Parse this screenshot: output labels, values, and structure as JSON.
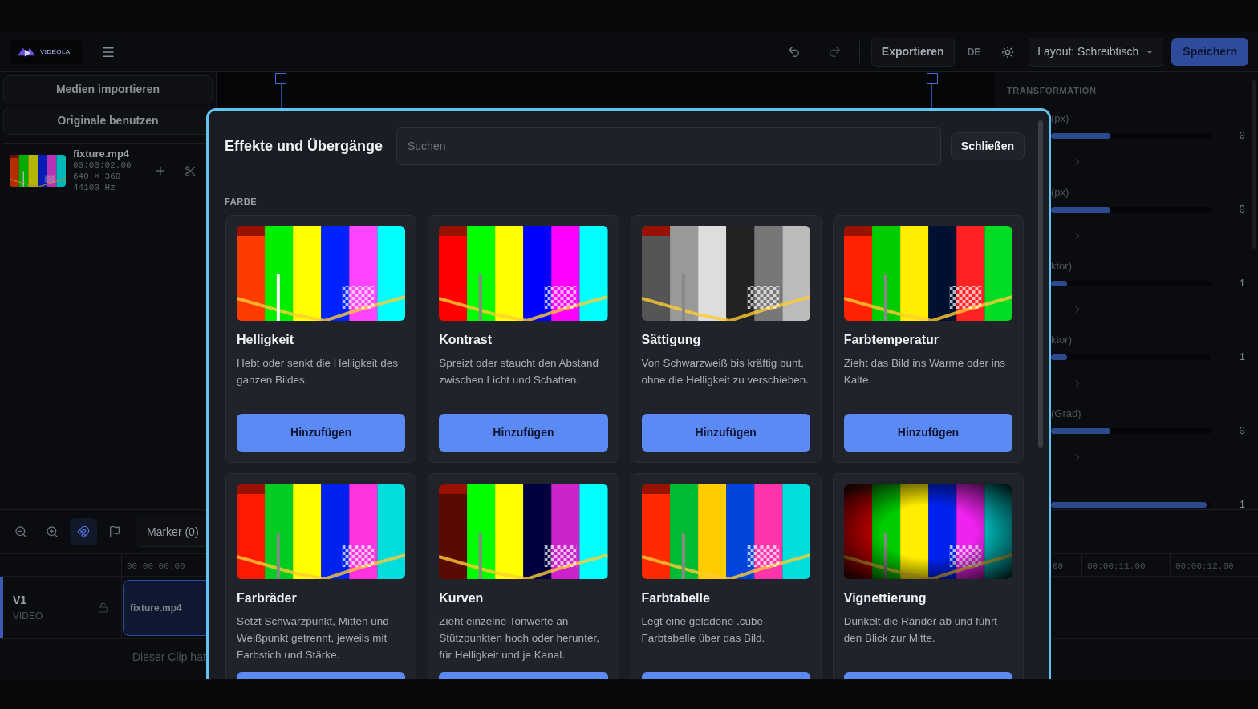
{
  "topbar": {
    "logo_text": "VIDEOLA",
    "export": "Exportieren",
    "language": "DE",
    "layout_select": "Layout: Schreibtisch",
    "save": "Speichern"
  },
  "media_panel": {
    "buttons": [
      "Medien importieren",
      "Originale benutzen"
    ],
    "items": [
      {
        "name": "fixture.mp4",
        "duration": "00:00:02.00",
        "resolution": "640 × 360",
        "sample_rate": "44100 Hz"
      }
    ]
  },
  "inspector": {
    "section": "TRANSFORMATION",
    "rows": [
      {
        "label": "(px)",
        "level": 0.37,
        "value": "0"
      },
      {
        "label": "(px)",
        "level": 0.37,
        "value": "0"
      },
      {
        "label": "ktor)",
        "level": 0.1,
        "value": "1"
      },
      {
        "label": "ktor)",
        "level": 0.1,
        "value": "1"
      },
      {
        "label": "(Grad)",
        "level": 0.37,
        "value": "0"
      },
      {
        "level": 0.97,
        "value": "1"
      }
    ]
  },
  "timeline": {
    "tools": [
      {
        "kind": "zoom-out",
        "selected": false
      },
      {
        "kind": "zoom-in",
        "selected": false
      },
      {
        "kind": "magnet",
        "selected": true
      },
      {
        "kind": "flag",
        "selected": false
      }
    ],
    "marker_button": "Marker (0)",
    "ruler": [
      "00:00:00.00",
      "00",
      "00:00:11.00",
      "00:00:12.00"
    ],
    "tracks": [
      {
        "name": "V1",
        "type": "VIDEO",
        "clip": "fixture.mp4"
      }
    ],
    "notice": "Dieser Clip hat"
  },
  "dialog": {
    "title": "Effekte und Übergänge",
    "search": {
      "placeholder": "Suchen"
    },
    "close": "Schließen",
    "section": "FARBE",
    "effects": [
      {
        "title": "Helligkeit",
        "description": "Hebt oder senkt die Helligkeit des ganzen Bildes.",
        "button": "Hinzufügen"
      },
      {
        "title": "Kontrast",
        "description": "Spreizt oder staucht den Abstand zwischen Licht und Schatten.",
        "button": "Hinzufügen"
      },
      {
        "title": "Sättigung",
        "description": "Von Schwarzweiß bis kräftig bunt, ohne die Helligkeit zu verschieben.",
        "button": "Hinzufügen"
      },
      {
        "title": "Farbtemperatur",
        "description": "Zieht das Bild ins Warme oder ins Kalte.",
        "button": "Hinzufügen"
      },
      {
        "title": "Farbräder",
        "description": "Setzt Schwarzpunkt, Mitten und Weißpunkt getrennt, jeweils mit Farbstich und Stärke."
      },
      {
        "title": "Kurven",
        "description": "Zieht einzelne Tonwerte an Stützpunkten hoch oder herunter, für Helligkeit und je Kanal."
      },
      {
        "title": "Farbtabelle",
        "description": "Legt eine geladene .cube-Farbtabelle über das Bild."
      },
      {
        "title": "Vignettierung",
        "description": "Dunkelt die Ränder ab und führt den Blick zur Mitte."
      }
    ]
  }
}
